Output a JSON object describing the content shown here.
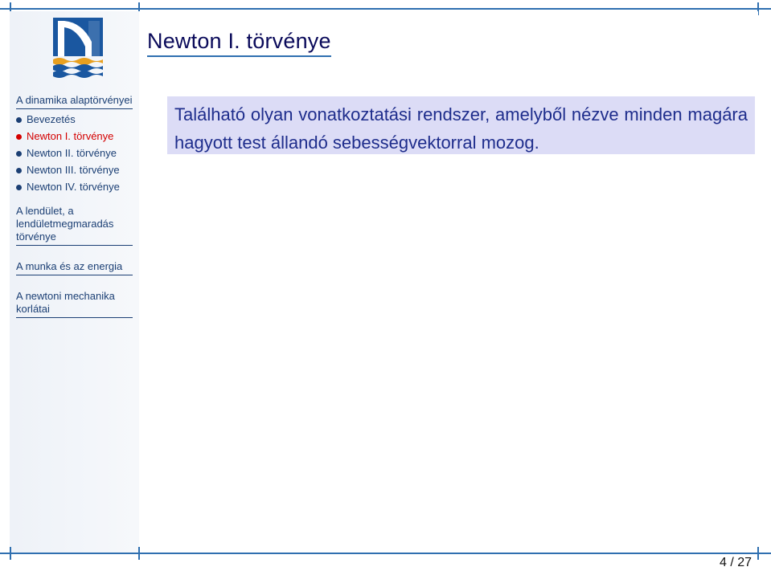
{
  "title": "Newton I. törvénye",
  "body_text": "Található olyan vonatkoztatási rendszer, amelyből nézve minden magára hagyott test állandó sebességvektorral mozog.",
  "nav": {
    "section1": "A dinamika alaptörvényei",
    "items": [
      {
        "label": "Bevezetés",
        "active": false
      },
      {
        "label": "Newton I. törvénye",
        "active": true
      },
      {
        "label": "Newton II. törvénye",
        "active": false
      },
      {
        "label": "Newton III. törvénye",
        "active": false
      },
      {
        "label": "Newton IV. törvénye",
        "active": false
      }
    ],
    "section2": "A lendület, a lendületmegmaradás törvénye",
    "section3": "A munka és az energia",
    "section4": "A newtoni mechanika korlátai"
  },
  "page": "4 / 27",
  "colors": {
    "accent": "#2f6fb0",
    "nav_text": "#1b3f74",
    "active": "#d40000",
    "block_bg": "#dcdcf6",
    "block_text": "#1e2d8c"
  }
}
